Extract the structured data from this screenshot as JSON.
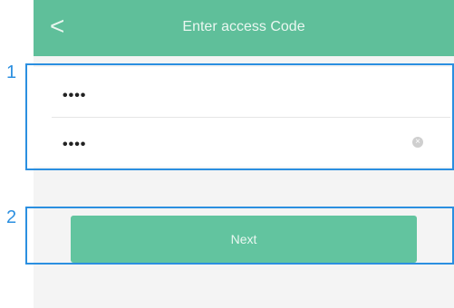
{
  "header": {
    "title": "Enter access Code",
    "back_icon": "chevron-left-icon",
    "color": "#5fbf9a"
  },
  "form": {
    "field1": {
      "value": "••••"
    },
    "field2": {
      "value": "••••",
      "clear_icon": "clear-icon"
    }
  },
  "actions": {
    "next_label": "Next",
    "color": "#62c49f"
  },
  "annotations": {
    "label1": "1",
    "label2": "2",
    "color": "#2b8fe0"
  }
}
